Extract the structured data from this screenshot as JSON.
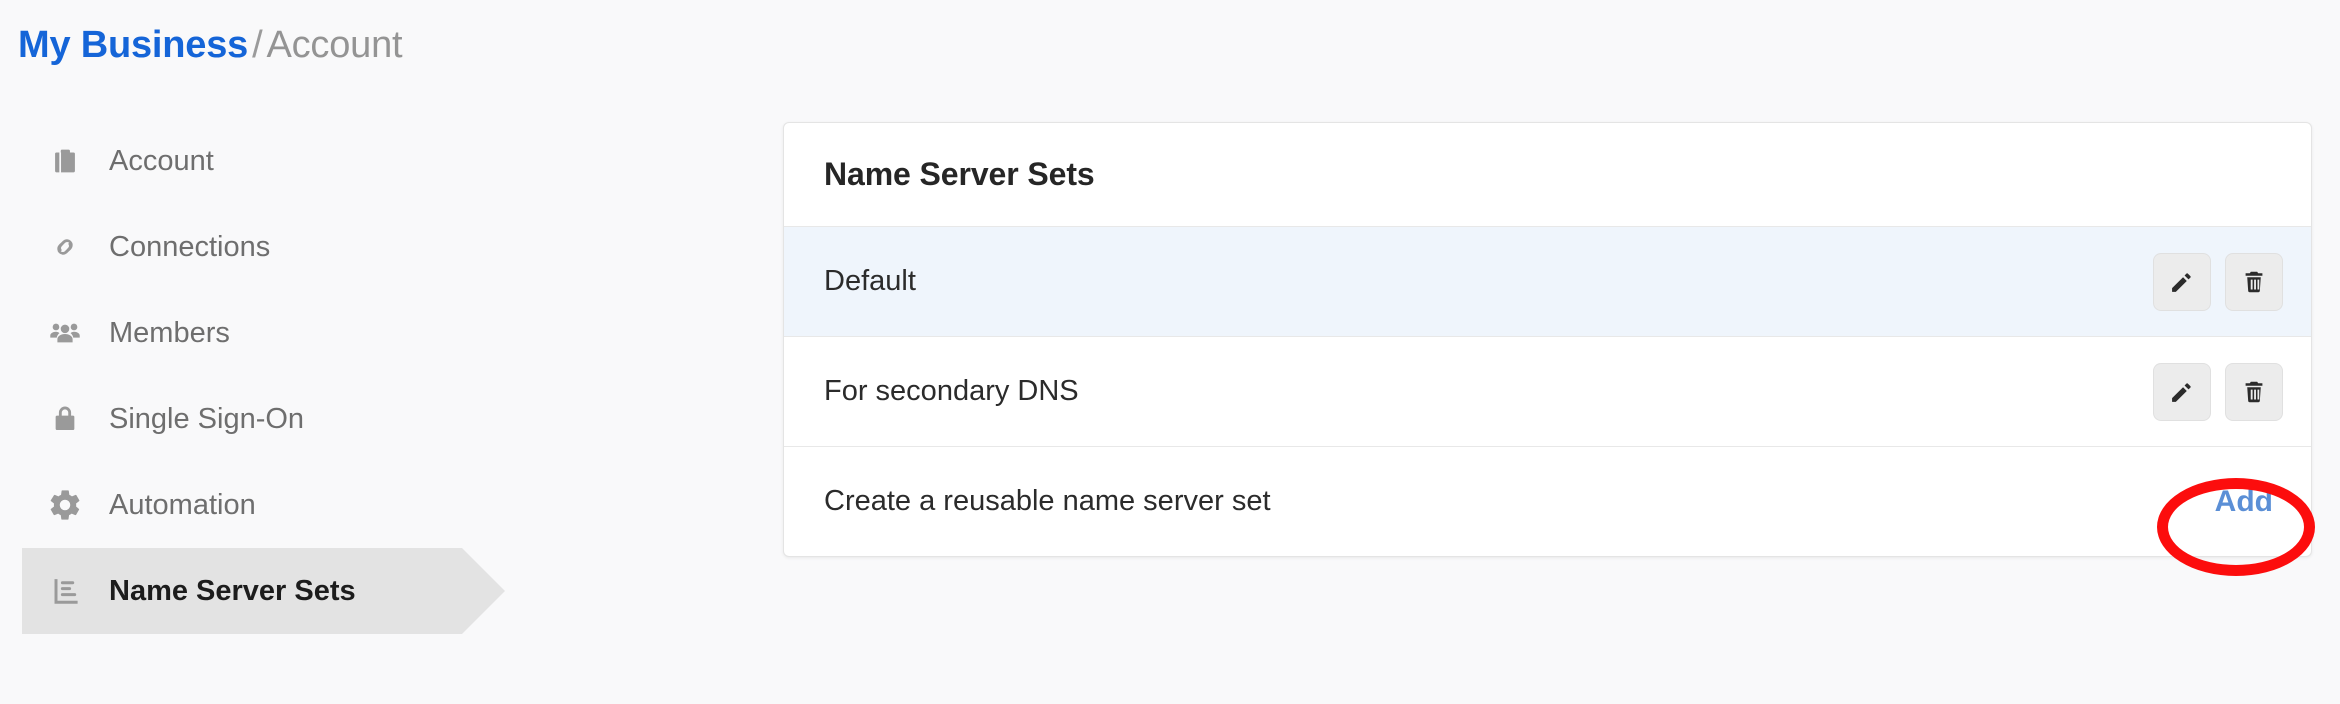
{
  "breadcrumb": {
    "root": "My Business",
    "separator": "/",
    "current": "Account"
  },
  "sidebar": {
    "items": [
      {
        "label": "Account",
        "icon": "briefcase-icon",
        "active": false
      },
      {
        "label": "Connections",
        "icon": "link-icon",
        "active": false
      },
      {
        "label": "Members",
        "icon": "people-icon",
        "active": false
      },
      {
        "label": "Single Sign-On",
        "icon": "lock-icon",
        "active": false
      },
      {
        "label": "Automation",
        "icon": "gear-icon",
        "active": false
      },
      {
        "label": "Name Server Sets",
        "icon": "list-bars-icon",
        "active": true
      }
    ]
  },
  "card": {
    "title": "Name Server Sets",
    "rows": [
      {
        "label": "Default",
        "highlight": true,
        "actions": [
          "edit-icon",
          "trash-icon"
        ]
      },
      {
        "label": "For secondary DNS",
        "highlight": false,
        "actions": [
          "edit-icon",
          "trash-icon"
        ]
      }
    ],
    "footer": {
      "label": "Create a reusable name server set",
      "add_label": "Add"
    }
  },
  "annotation": {
    "shape": "ellipse",
    "color": "#fc0d0d",
    "target": "Add"
  },
  "colors": {
    "page_background": "#f9f9fa",
    "card_background": "#ffffff",
    "link_blue": "#1565d8",
    "add_blue": "#5b8fd6",
    "row_highlight": "#eff5fc",
    "sidebar_active": "#e3e3e3",
    "annotation_red": "#fc0d0d"
  }
}
